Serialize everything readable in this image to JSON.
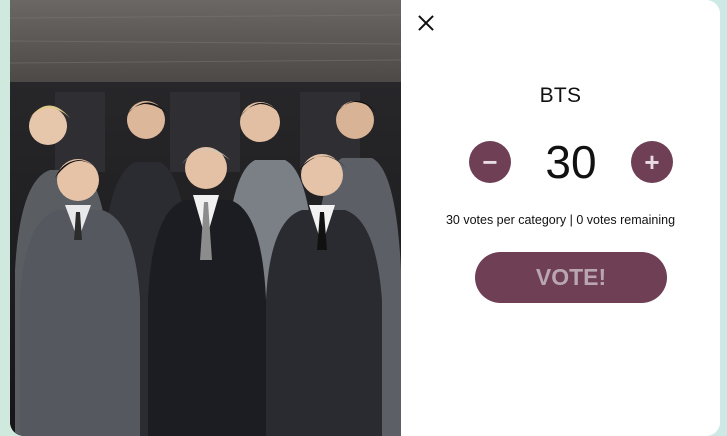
{
  "modal": {
    "close_icon": "close-icon",
    "photo_alt": "BTS group photo"
  },
  "vote": {
    "group_name": "BTS",
    "count": "30",
    "minus_label": "−",
    "plus_label": "+",
    "info": "30 votes per category | 0 votes remaining",
    "vote_label": "VOTE!"
  },
  "colors": {
    "accent": "#6e3f55",
    "accent_text": "#b9a6b0",
    "background": "#d3ece3"
  }
}
